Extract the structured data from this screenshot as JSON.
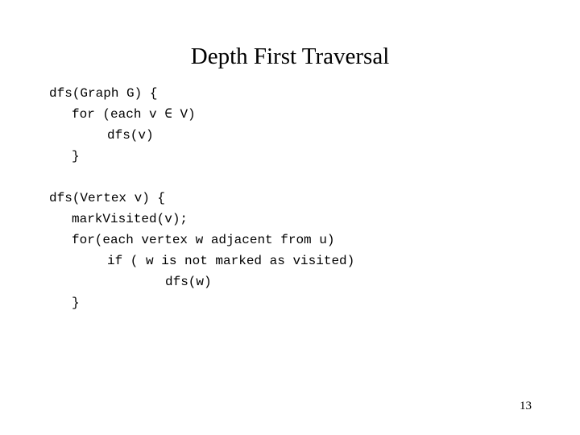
{
  "slide": {
    "title": "Depth First Traversal",
    "page_number": "13",
    "code_blocks": [
      {
        "lines": [
          "dfs(Graph G) {",
          "for (each v ∈ V)",
          "dfs(v)",
          "}"
        ]
      },
      {
        "lines": [
          "dfs(Vertex v) {",
          "markVisited(v);",
          "for(each vertex w adjacent from u)",
          "if ( w is not marked as visited)",
          "dfs(w)",
          "}"
        ]
      }
    ]
  }
}
